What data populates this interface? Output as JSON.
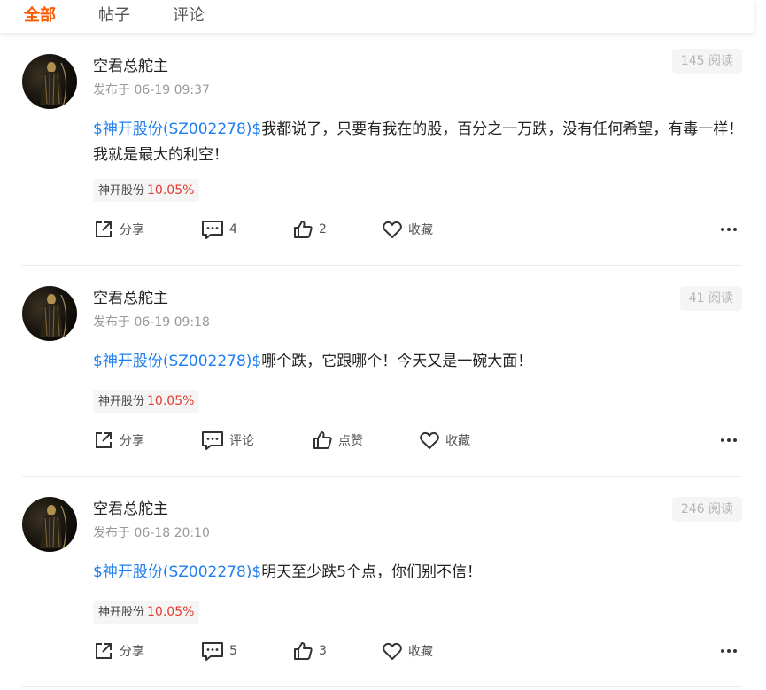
{
  "tabs": [
    {
      "label": "全部",
      "active": true
    },
    {
      "label": "帖子",
      "active": false
    },
    {
      "label": "评论",
      "active": false
    }
  ],
  "colors": {
    "accent": "#ff5a00",
    "link": "#1e7ef0",
    "up": "#e33b2e"
  },
  "posts": [
    {
      "author": "空君总舵主",
      "time": "发布于 06-19 09:37",
      "reads": "145 阅读",
      "stock_link": "$神开股份(SZ002278)$",
      "text": "我都说了，只要有我在的股，百分之一万跌，没有任何希望，有毒一样！我就是最大的利空！",
      "chip": {
        "name": "神开股份",
        "pct": "10.05%"
      },
      "actions": {
        "share": "分享",
        "comment": "4",
        "like": "2",
        "favorite": "收藏"
      }
    },
    {
      "author": "空君总舵主",
      "time": "发布于 06-19 09:18",
      "reads": "41 阅读",
      "stock_link": "$神开股份(SZ002278)$",
      "text": "哪个跌，它跟哪个！今天又是一碗大面！",
      "chip": {
        "name": "神开股份",
        "pct": "10.05%"
      },
      "actions": {
        "share": "分享",
        "comment": "评论",
        "like": "点赞",
        "favorite": "收藏"
      }
    },
    {
      "author": "空君总舵主",
      "time": "发布于 06-18 20:10",
      "reads": "246 阅读",
      "stock_link": "$神开股份(SZ002278)$",
      "text": "明天至少跌5个点，你们别不信！",
      "chip": {
        "name": "神开股份",
        "pct": "10.05%"
      },
      "actions": {
        "share": "分享",
        "comment": "5",
        "like": "3",
        "favorite": "收藏"
      }
    }
  ]
}
